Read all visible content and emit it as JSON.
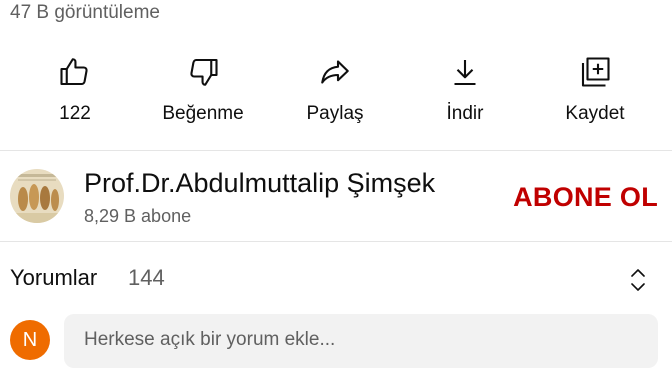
{
  "video": {
    "views_text": "47 B görüntüleme"
  },
  "actions": [
    {
      "icon": "thumbs-up-icon",
      "label": "122"
    },
    {
      "icon": "thumbs-down-icon",
      "label": "Beğenme"
    },
    {
      "icon": "share-icon",
      "label": "Paylaş"
    },
    {
      "icon": "download-icon",
      "label": "İndir"
    },
    {
      "icon": "save-to-playlist-icon",
      "label": "Kaydet"
    }
  ],
  "channel": {
    "name": "Prof.Dr.Abdulmuttalip Şimşek",
    "subscribers": "8,29 B abone",
    "subscribe_label": "ABONE OL",
    "subscribe_color": "#c00000"
  },
  "comments": {
    "title": "Yorumlar",
    "count": "144",
    "user_initial": "N",
    "user_avatar_color": "#ef6c00",
    "placeholder": "Herkese açık bir yorum ekle..."
  }
}
